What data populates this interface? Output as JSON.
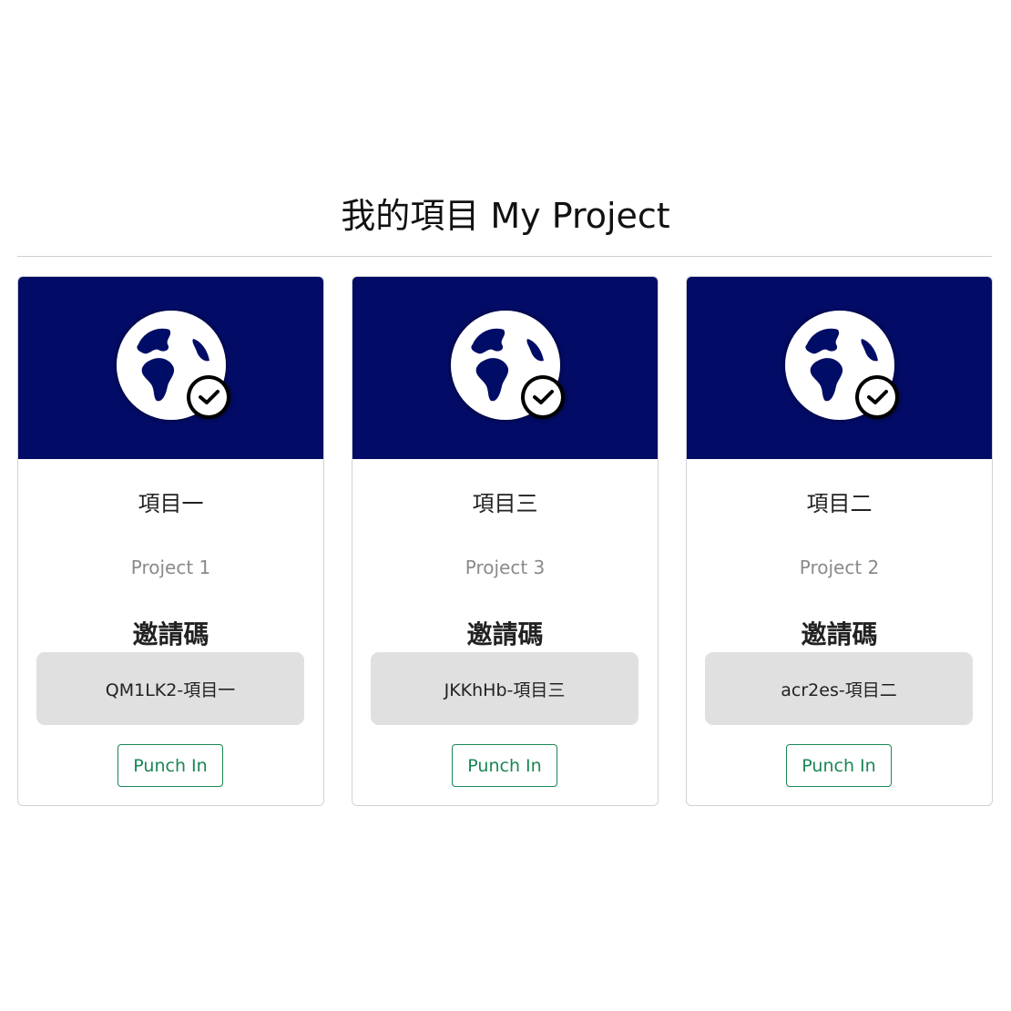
{
  "page": {
    "title": "我的項目 My Project"
  },
  "colors": {
    "banner": "#020b66",
    "accent": "#198754",
    "code_bg": "#e0e0e0"
  },
  "projects": [
    {
      "name_zh": "項目一",
      "name_en": "Project 1",
      "invite_label": "邀請碼",
      "invite_code": "QM1LK2-項目一",
      "button_label": "Punch In",
      "icon": "globe-check-icon"
    },
    {
      "name_zh": "項目三",
      "name_en": "Project 3",
      "invite_label": "邀請碼",
      "invite_code": "JKKhHb-項目三",
      "button_label": "Punch In",
      "icon": "globe-check-icon"
    },
    {
      "name_zh": "項目二",
      "name_en": "Project 2",
      "invite_label": "邀請碼",
      "invite_code": "acr2es-項目二",
      "button_label": "Punch In",
      "icon": "globe-check-icon"
    }
  ]
}
